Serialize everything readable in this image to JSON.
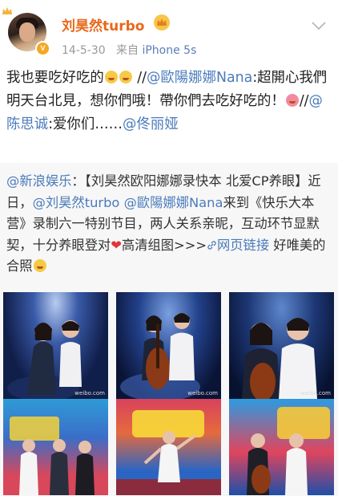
{
  "post": {
    "username": "刘昊然turbo",
    "timestamp": "14-5-30",
    "source_prefix": "来自",
    "source_device": "iPhone 5s",
    "avatar_badge": "V",
    "text_part1": "我也要吃好吃的",
    "text_part2": " //",
    "mention1": "@歐陽娜娜Nana",
    "text_part3": ":超開心我們明天台北見，想你們哦！帶你們去吃好吃的！",
    "text_part4": "//",
    "mention2": "@陈思诚",
    "text_part5": ":爱你们……",
    "mention3": "@佟丽娅"
  },
  "repost": {
    "author": "@新浪娱乐",
    "text1": "：【刘昊然欧阳娜娜录快本 北爱CP养眼】近日，",
    "mention1": "@刘昊然turbo",
    "mention2": "@歐陽娜娜Nana",
    "text2": "来到《快乐大本营》录制六一特别节目，两人关系亲昵，互动环节显默契，十分养眼登对",
    "heart": "❤",
    "text3": "高清组图>>>",
    "link_label": "网页链接",
    "text4": " 好唯美的合照",
    "photo_watermarks": [
      "weibo.com",
      "weibo.com",
      "weibo.com",
      "",
      "",
      ""
    ]
  },
  "colors": {
    "username": "#e8681a",
    "link": "#4a7bbb",
    "meta": "#999999",
    "repost_bg": "#f7f7f7"
  },
  "icons": [
    "crown-icon",
    "vip-crown-icon",
    "verified-badge-icon",
    "chevron-down-icon",
    "link-icon",
    "emoji-icon"
  ]
}
